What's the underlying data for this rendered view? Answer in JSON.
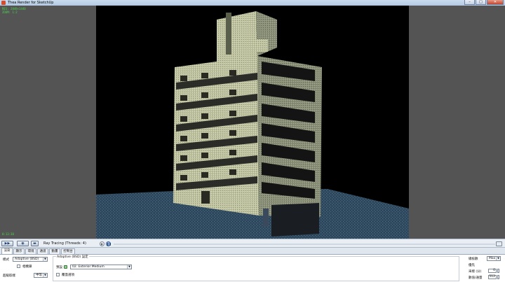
{
  "window": {
    "title": "Thea Render for SketchUp",
    "minimize": "–",
    "maximize": "□",
    "close": "✕"
  },
  "viewport": {
    "osd_line1": "RES: 2048×1440",
    "osd_line2": "ZOOM: 1:2",
    "osd_bottom": "0:13:30",
    "accent": "#4cd64c"
  },
  "toolbar": {
    "status": "Ray Tracing (Threads: 4)",
    "progress": 0.0
  },
  "tabs": [
    "渲染",
    "顯示",
    "環境",
    "通道",
    "動畫",
    "控制台"
  ],
  "settings": {
    "mode_label": "模式",
    "mode_value": "Adaptive (BSD)",
    "checkbox_label": "相機鎖",
    "quality_label": "超級取樣",
    "quality_value": "中等",
    "group_title": "Adaptive (BSD) 設定",
    "preset_label": "預設",
    "preset_value": "02. Exterior Medium",
    "group_checkbox_label": "覆蓋選項",
    "right_label1": "總核數",
    "right_value1": "Max",
    "right_label2": "優先",
    "right_label3": "采樣 (分)",
    "right_value3": "0",
    "right_label4": "數值/通量",
    "right_value4": "512"
  }
}
